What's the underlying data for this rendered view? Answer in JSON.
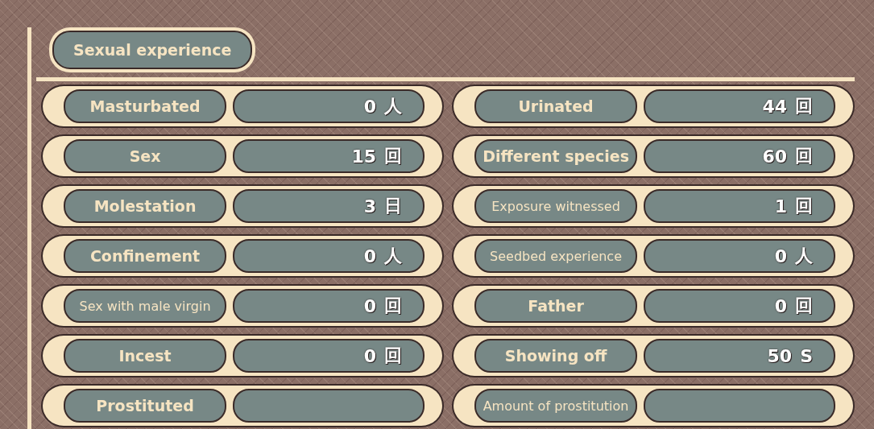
{
  "section": {
    "title": "Sexual experience"
  },
  "columns": [
    {
      "rows": [
        {
          "label": "Masturbated",
          "count": "0",
          "unit": "人"
        },
        {
          "label": "Sex",
          "count": "15",
          "unit": "回"
        },
        {
          "label": "Molestation",
          "count": "3",
          "unit": "日"
        },
        {
          "label": "Confinement",
          "count": "0",
          "unit": "人"
        },
        {
          "label": "Sex with male virgin",
          "count": "0",
          "unit": "回"
        },
        {
          "label": "Incest",
          "count": "0",
          "unit": "回"
        },
        {
          "label": "Prostituted"
        }
      ]
    },
    {
      "rows": [
        {
          "label": "Urinated",
          "count": "44",
          "unit": "回"
        },
        {
          "label": "Different species",
          "count": "60",
          "unit": "回"
        },
        {
          "label": "Exposure witnessed",
          "count": "1",
          "unit": "回"
        },
        {
          "label": "Seedbed experience",
          "count": "0",
          "unit": "人"
        },
        {
          "label": "Father",
          "count": "0",
          "unit": "回"
        },
        {
          "label": "Showing off",
          "count": "50",
          "unit": "S"
        },
        {
          "label": "Amount of prostitution"
        }
      ]
    }
  ]
}
